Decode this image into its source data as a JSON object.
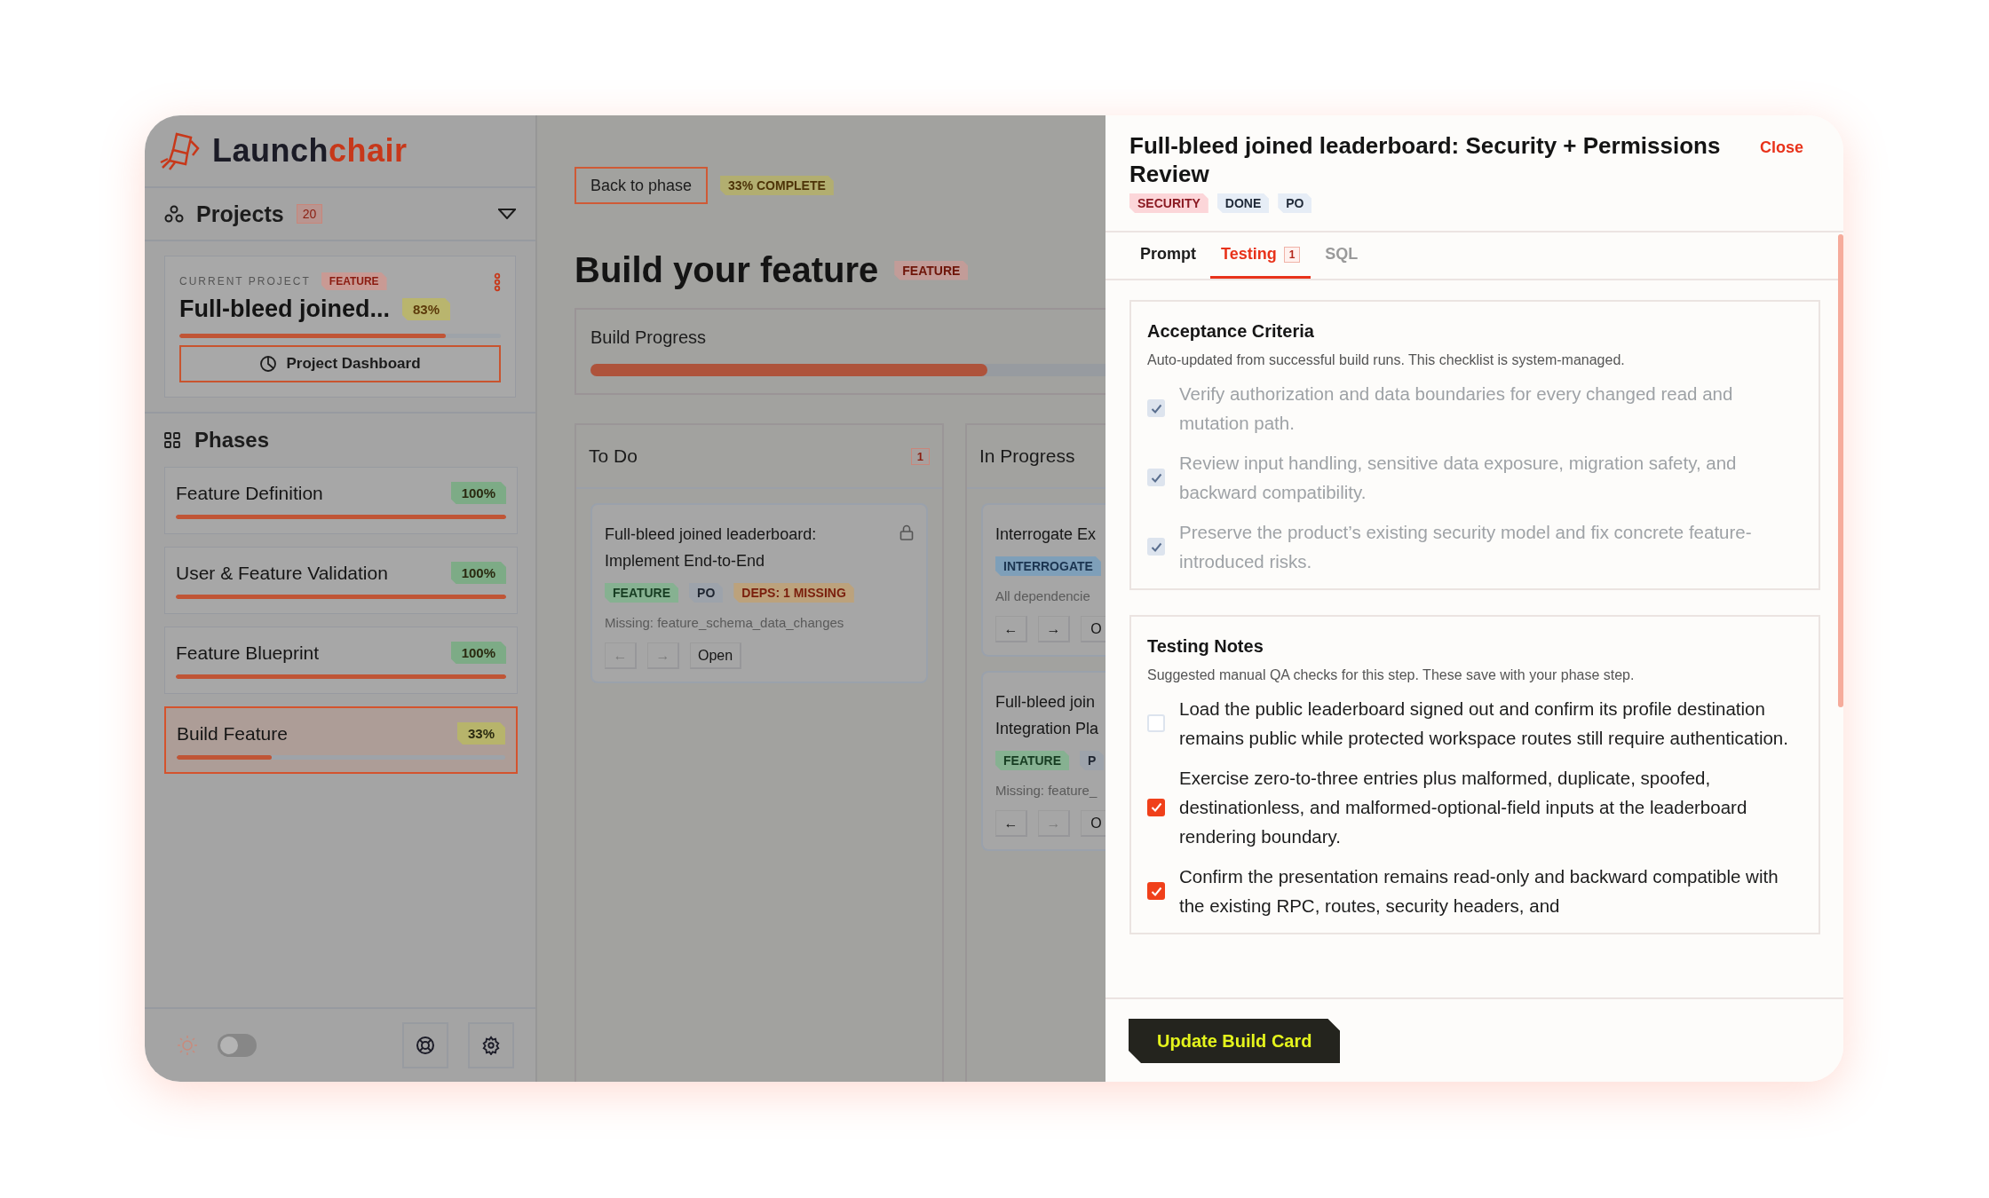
{
  "logo": {
    "text_dark": "Launch",
    "text_accent": "chair"
  },
  "sidebar": {
    "projects": {
      "label": "Projects",
      "count": "20"
    },
    "current_project": {
      "caption": "CURRENT PROJECT",
      "tag": "FEATURE",
      "name": "Full-bleed joined...",
      "percent": "83%",
      "level": 0.83,
      "dashboard_button": "Project Dashboard"
    },
    "phases": {
      "title": "Phases",
      "items": [
        {
          "name": "Feature Definition",
          "percent": "100%",
          "level": 1,
          "color": "#7dab86",
          "selected": false
        },
        {
          "name": "User & Feature Validation",
          "percent": "100%",
          "level": 1,
          "color": "#7dab86",
          "selected": false
        },
        {
          "name": "Feature Blueprint",
          "percent": "100%",
          "level": 1,
          "color": "#7dab86",
          "selected": false
        },
        {
          "name": "Build Feature",
          "percent": "33%",
          "level": 0.29,
          "color": "#b7b46b",
          "selected": true
        }
      ]
    },
    "theme_toggle": {
      "on": false
    }
  },
  "main": {
    "back_button": "Back to phase",
    "completion": "33% COMPLETE",
    "title": "Build your feature",
    "title_tag": "FEATURE",
    "progress": {
      "label": "Build Progress",
      "level": 0.77
    },
    "columns": [
      {
        "title": "To Do",
        "count": "1",
        "cards": [
          {
            "title": "Full-bleed joined leaderboard: Implement End-to-End",
            "locked": true,
            "tags": [
              {
                "label": "FEATURE",
                "kind": "feature"
              },
              {
                "label": "PO",
                "kind": "role"
              },
              {
                "label": "DEPS: 1 MISSING",
                "kind": "deps"
              }
            ],
            "note": "Missing: feature_schema_data_changes",
            "actions": [
              {
                "label": "←",
                "disabled": true
              },
              {
                "label": "→",
                "disabled": true
              },
              {
                "label": "Open",
                "disabled": false
              }
            ]
          }
        ]
      },
      {
        "title": "In Progress",
        "cards": [
          {
            "title": "Interrogate Ex",
            "locked": false,
            "tags": [
              {
                "label": "INTERROGATE",
                "kind": "interrogate"
              }
            ],
            "note": "All dependencie",
            "actions": [
              {
                "label": "←",
                "disabled": false
              },
              {
                "label": "→",
                "disabled": false
              },
              {
                "label": "O",
                "disabled": false
              }
            ]
          },
          {
            "title": "Full-bleed join Integration Pla",
            "locked": false,
            "tags": [
              {
                "label": "FEATURE",
                "kind": "feature"
              },
              {
                "label": "P",
                "kind": "role"
              }
            ],
            "note": "Missing: feature_",
            "actions": [
              {
                "label": "←",
                "disabled": false
              },
              {
                "label": "→",
                "disabled": true
              },
              {
                "label": "O",
                "disabled": false
              }
            ]
          }
        ]
      }
    ]
  },
  "drawer": {
    "title": "Full-bleed joined leaderboard: Security + Permissions Review",
    "close": "Close",
    "tags": [
      {
        "label": "SECURITY",
        "kind": "security"
      },
      {
        "label": "DONE",
        "kind": "status"
      },
      {
        "label": "PO",
        "kind": "role"
      }
    ],
    "tabs": [
      {
        "label": "Prompt",
        "selected": false,
        "disabled": false
      },
      {
        "label": "Testing",
        "count": "1",
        "selected": true,
        "disabled": false
      },
      {
        "label": "SQL",
        "selected": false,
        "disabled": true
      }
    ],
    "sections": [
      {
        "title": "Acceptance Criteria",
        "description": "Auto-updated from successful build runs. This checklist is system-managed.",
        "items": [
          {
            "text": "Verify authorization and data boundaries for every changed read and mutation path.",
            "checked": true,
            "disabled": true
          },
          {
            "text": "Review input handling, sensitive data exposure, migration safety, and backward compatibility.",
            "checked": true,
            "disabled": true
          },
          {
            "text": "Preserve the product’s existing security model and fix concrete feature-introduced risks.",
            "checked": true,
            "disabled": true
          }
        ]
      },
      {
        "title": "Testing Notes",
        "description": "Suggested manual QA checks for this step. These save with your phase step.",
        "items": [
          {
            "text": "Load the public leaderboard signed out and confirm its profile destination remains public while protected workspace routes still require authentication.",
            "checked": false,
            "disabled": false
          },
          {
            "text": "Exercise zero-to-three entries plus malformed, duplicate, spoofed, destinationless, and malformed-optional-field inputs at the leaderboard rendering boundary.",
            "checked": true,
            "disabled": false
          },
          {
            "text": "Confirm the presentation remains read-only and backward compatible with the existing RPC, routes, security headers, and",
            "checked": true,
            "disabled": false
          }
        ]
      }
    ],
    "primary_button": "Update Build Card"
  }
}
